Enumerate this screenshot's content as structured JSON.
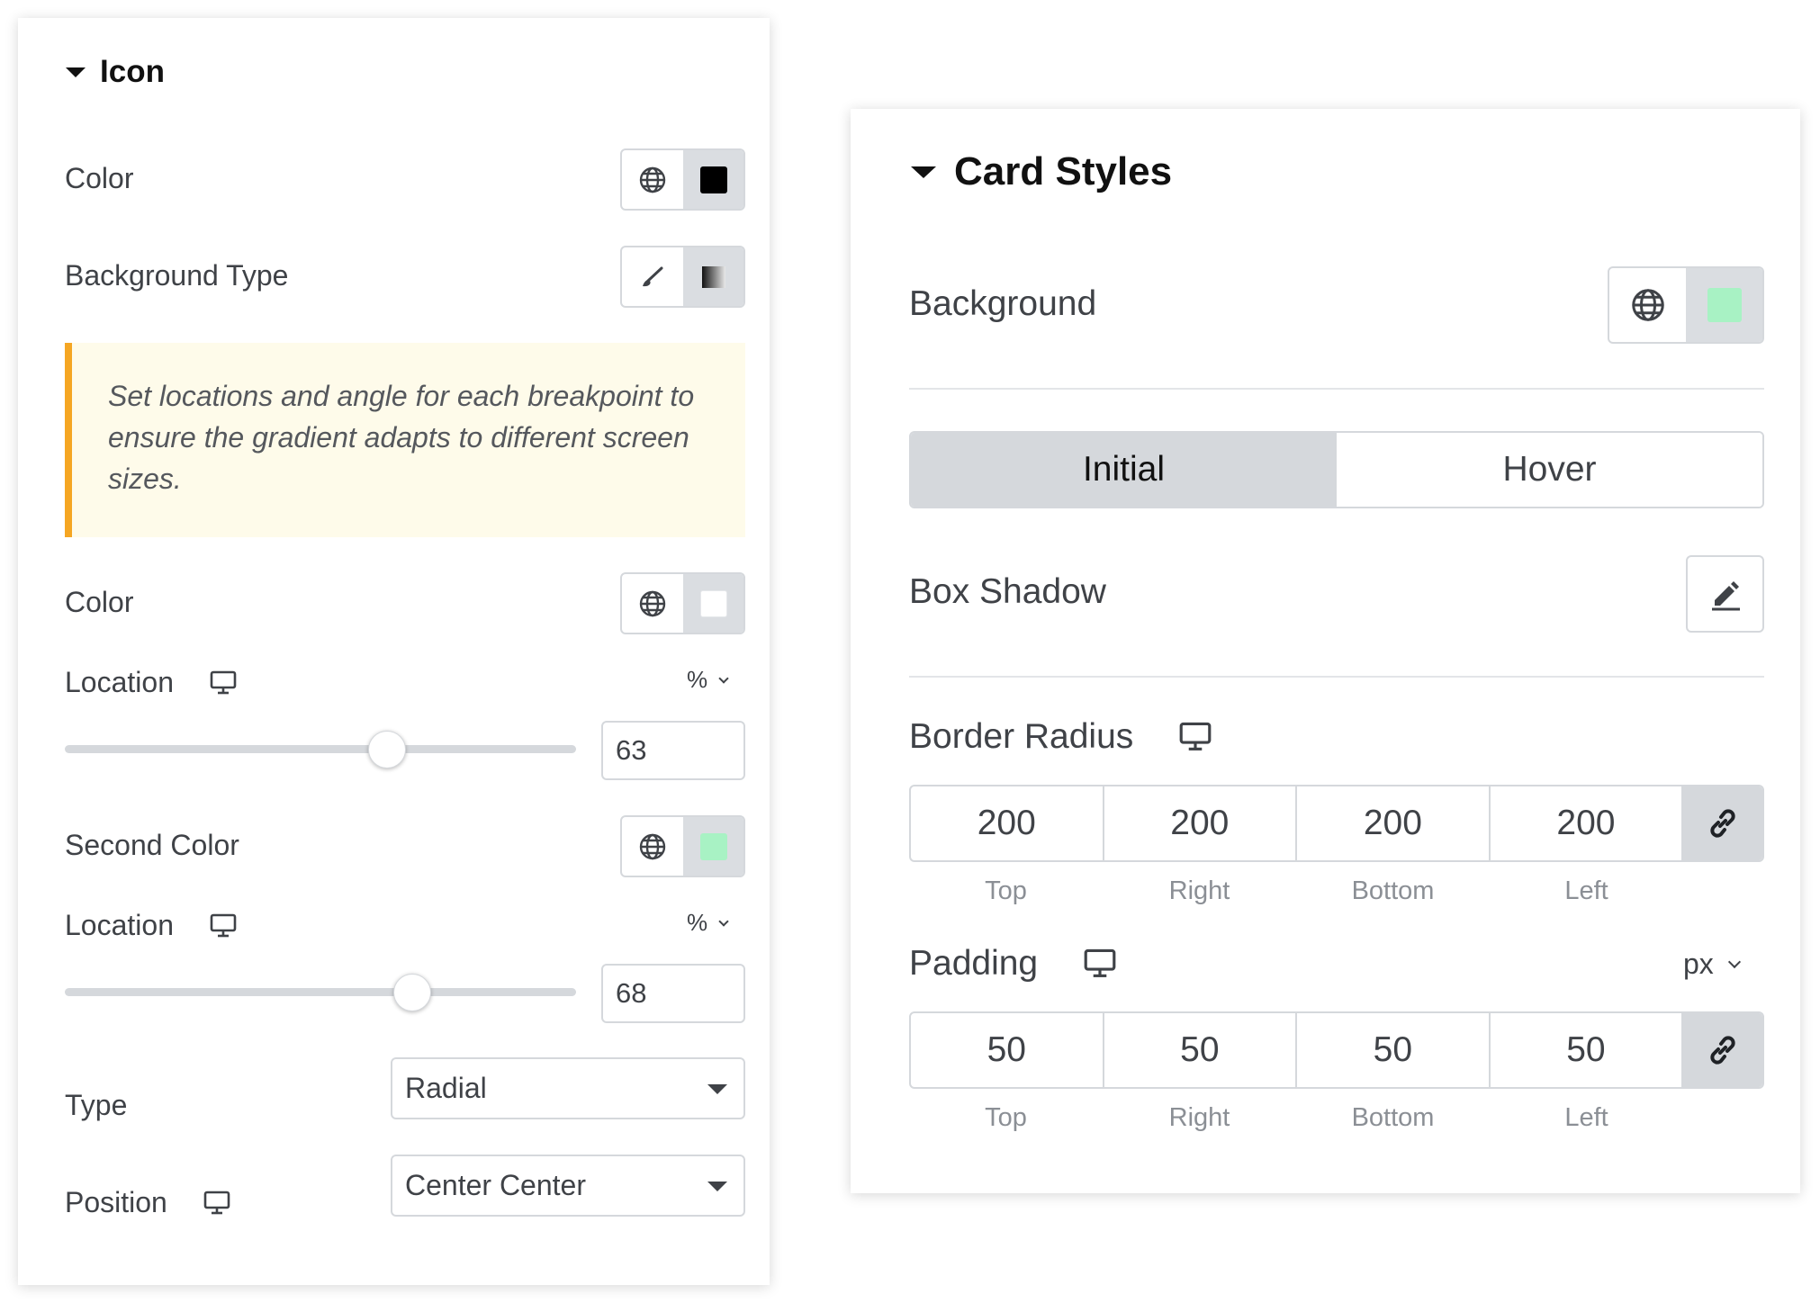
{
  "left_panel": {
    "heading": "Icon",
    "color": {
      "label": "Color",
      "swatch": "#000000"
    },
    "background_type": {
      "label": "Background Type"
    },
    "notice": "Set locations and angle for each breakpoint to ensure the gradient adapts to different screen sizes.",
    "first_color": {
      "label": "Color",
      "swatch": "#ffffff"
    },
    "location_1": {
      "label": "Location",
      "unit": "%",
      "value": "63",
      "fraction": 0.63
    },
    "second_color": {
      "label": "Second Color",
      "swatch": "#a8f2c4"
    },
    "location_2": {
      "label": "Location",
      "unit": "%",
      "value": "68",
      "fraction": 0.68
    },
    "type": {
      "label": "Type",
      "value": "Radial"
    },
    "position": {
      "label": "Position",
      "value": "Center Center"
    }
  },
  "right_panel": {
    "heading": "Card Styles",
    "background": {
      "label": "Background",
      "swatch": "#a8f2c4"
    },
    "tabs": [
      {
        "label": "Initial",
        "active": true
      },
      {
        "label": "Hover",
        "active": false
      }
    ],
    "box_shadow": {
      "label": "Box Shadow"
    },
    "border_radius": {
      "label": "Border Radius",
      "values": [
        "200",
        "200",
        "200",
        "200"
      ],
      "sides": [
        "Top",
        "Right",
        "Bottom",
        "Left"
      ]
    },
    "padding": {
      "label": "Padding",
      "unit": "px",
      "values": [
        "50",
        "50",
        "50",
        "50"
      ],
      "sides": [
        "Top",
        "Right",
        "Bottom",
        "Left"
      ]
    }
  }
}
